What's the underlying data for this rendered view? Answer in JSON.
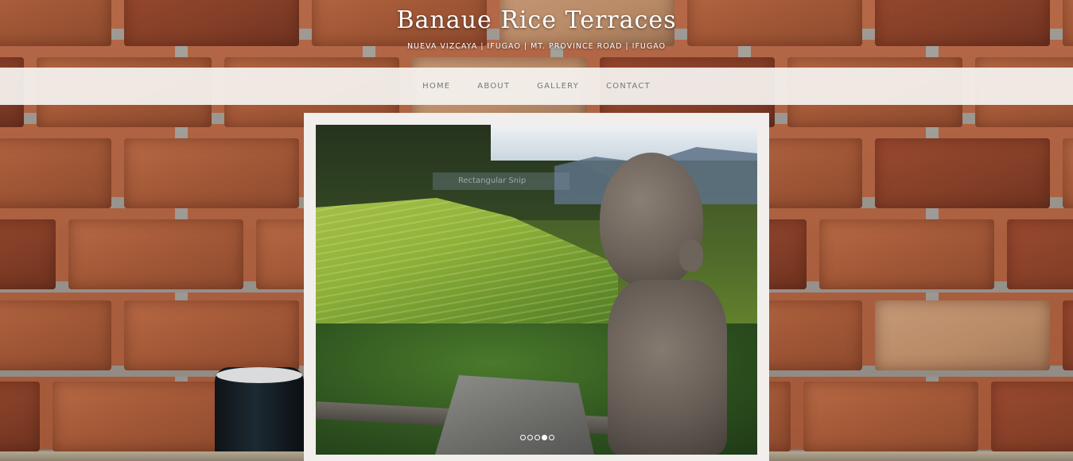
{
  "header": {
    "title": "Banaue Rice Terraces",
    "subtitle": "NUEVA VIZCAYA | IFUGAO | MT. PROVINCE ROAD | IFUGAO"
  },
  "nav": {
    "items": [
      {
        "label": "HOME"
      },
      {
        "label": "ABOUT"
      },
      {
        "label": "GALLERY"
      },
      {
        "label": "CONTACT"
      }
    ]
  },
  "slider": {
    "overlay_text": "Rectangular Snip",
    "slide_count": 5,
    "active_index": 3
  },
  "colors": {
    "nav_background": "#f5f3f0",
    "nav_text": "#777777",
    "title_text": "#ffffff",
    "frame_background": "#f1eeeb"
  }
}
